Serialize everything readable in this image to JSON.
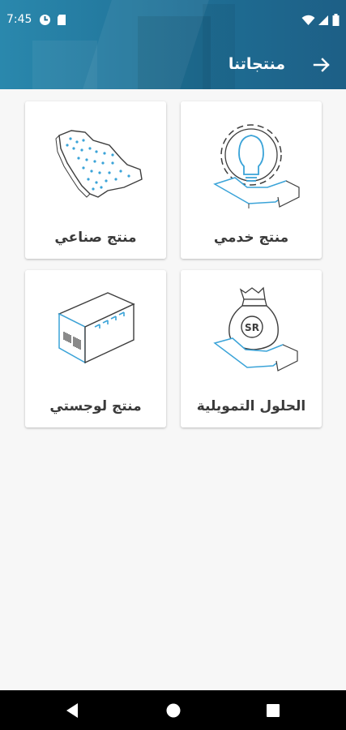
{
  "status_bar": {
    "time": "7:45",
    "icons_left": [
      "data-saver-icon",
      "sd-card-icon"
    ],
    "icons_right": [
      "wifi-icon",
      "signal-icon",
      "battery-icon"
    ]
  },
  "app_bar": {
    "title": "منتجاتنا",
    "back_icon": "arrow-icon"
  },
  "products": [
    {
      "label": "منتج خدمي",
      "icon": "lightbulb-gear-icon"
    },
    {
      "label": "منتج صناعي",
      "icon": "saudi-map-icon"
    },
    {
      "label": "الحلول التمويلية",
      "icon": "money-bag-hand-icon"
    },
    {
      "label": "منتج لوجستي",
      "icon": "warehouse-icon"
    }
  ],
  "nav_bar": {
    "buttons": [
      "back-triangle-icon",
      "home-circle-icon",
      "recents-square-icon"
    ]
  },
  "colors": {
    "header_start": "#2a88ad",
    "header_end": "#1d5f86",
    "accent_blue": "#3aa3d8",
    "label_text": "#3a3a3a",
    "background": "#f7f7f7"
  }
}
